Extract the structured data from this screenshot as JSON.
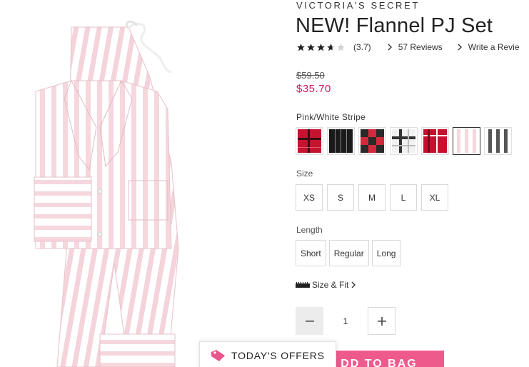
{
  "brand": "VICTORIA'S SECRET",
  "product": {
    "title": "NEW! Flannel PJ Set",
    "rating": 3.7,
    "rating_text": "(3.7)",
    "reviews_link": "57 Reviews",
    "write_review_link": "Write a Revie"
  },
  "price": {
    "original": "$59.50",
    "sale": "$35.70",
    "sale_color": "#d1175f"
  },
  "color": {
    "selected_label": "Pink/White Stripe",
    "swatches": [
      {
        "name": "red-black-plaid",
        "selected": false
      },
      {
        "name": "black-stripe",
        "selected": false
      },
      {
        "name": "red-black-check",
        "selected": false
      },
      {
        "name": "black-white-plaid",
        "selected": false
      },
      {
        "name": "red-plaid",
        "selected": false
      },
      {
        "name": "pink-white-stripe",
        "selected": true
      },
      {
        "name": "grey-white-stripe",
        "selected": false
      }
    ]
  },
  "size": {
    "label": "Size",
    "options": [
      "XS",
      "S",
      "M",
      "L",
      "XL"
    ]
  },
  "length": {
    "label": "Length",
    "options": [
      "Short",
      "Regular",
      "Long"
    ]
  },
  "size_fit": {
    "label": "Size & Fit",
    "icon": "ruler-icon"
  },
  "quantity": {
    "value": "1",
    "minus_icon": "minus-icon",
    "plus_icon": "plus-icon"
  },
  "add_to_bag": {
    "label": "DD TO BAG",
    "color": "#ef5a8c"
  },
  "offers": {
    "label": "TODAY'S OFFERS",
    "icon": "tag-icon",
    "icon_color": "#e8558a"
  }
}
